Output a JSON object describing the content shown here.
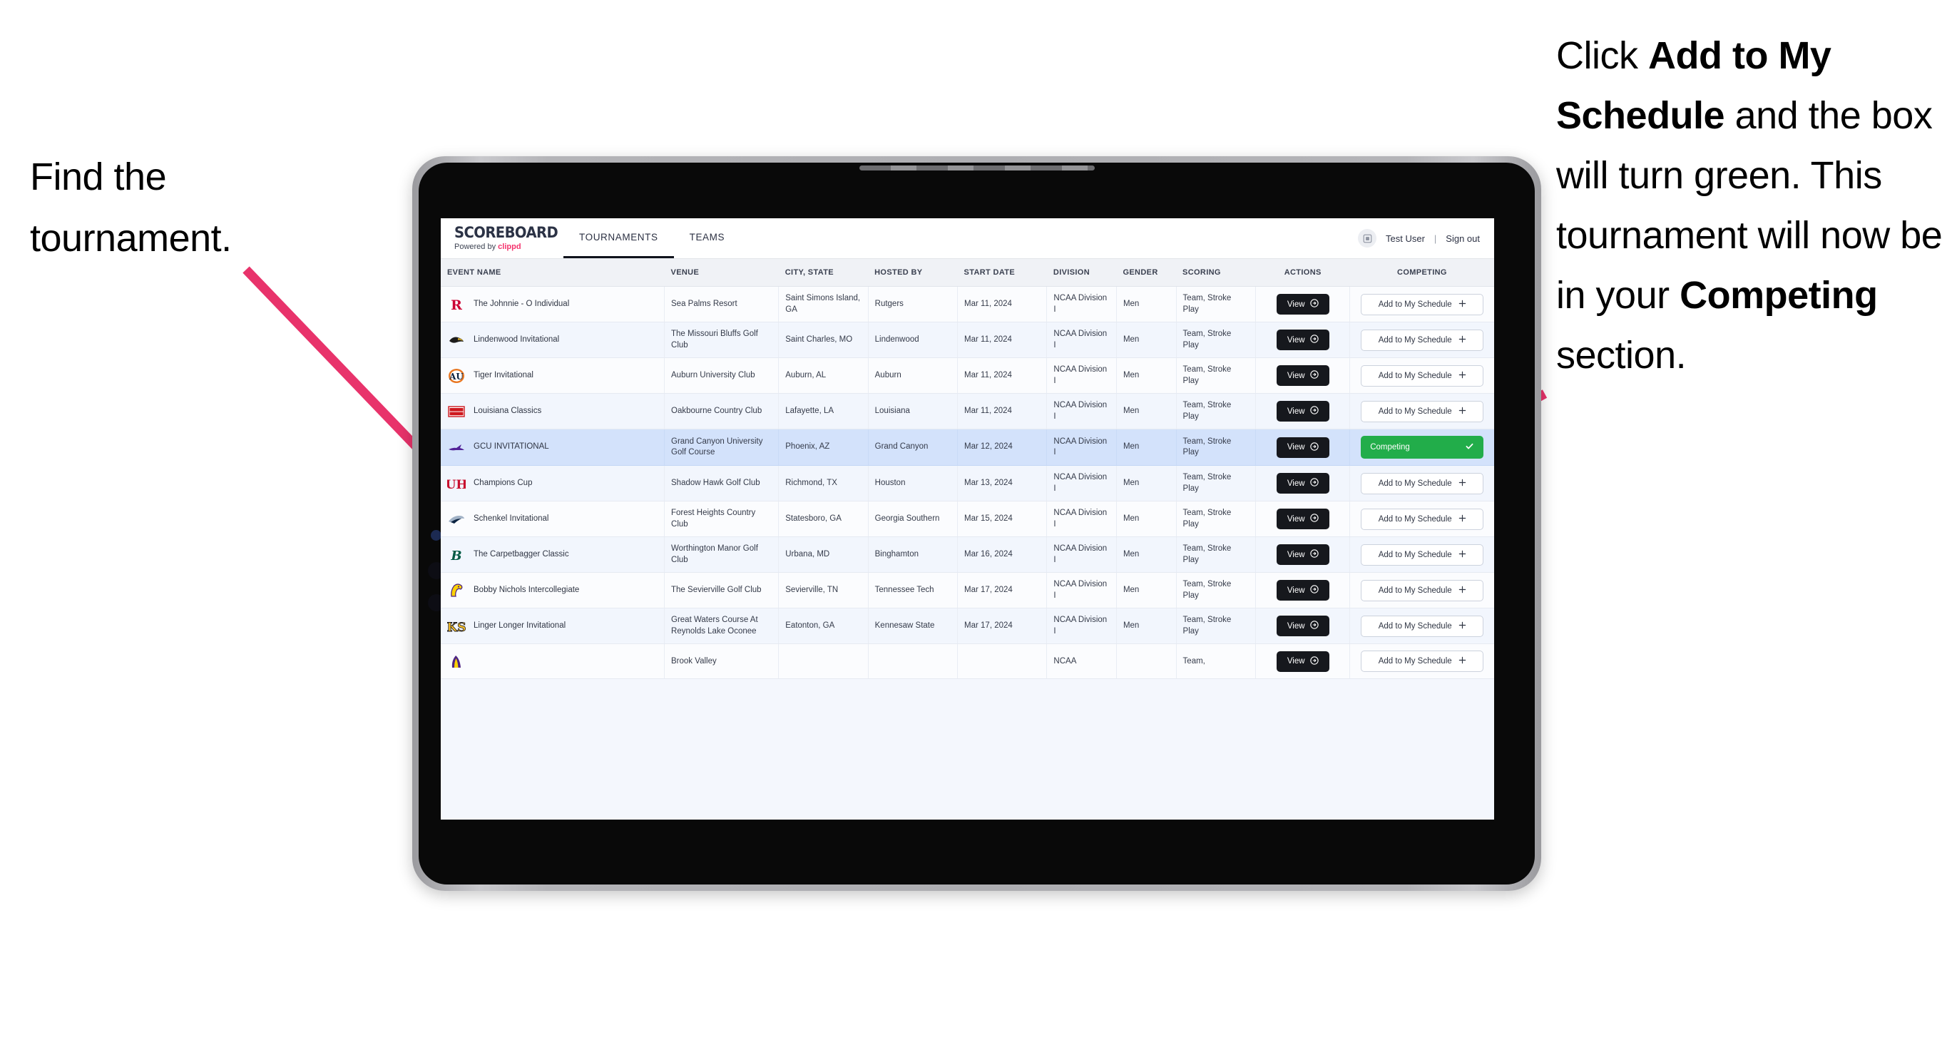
{
  "annotations": {
    "left": {
      "lines": [
        "Find the",
        "tournament."
      ]
    },
    "right": {
      "segments": [
        {
          "text": "Click ",
          "bold": false
        },
        {
          "text": "Add to My Schedule",
          "bold": true
        },
        {
          "text": " and the box will turn green. This tournament will now be in your ",
          "bold": false
        },
        {
          "text": "Competing",
          "bold": true
        },
        {
          "text": " section.",
          "bold": false
        }
      ]
    },
    "arrow_color": "#E8336B"
  },
  "app": {
    "brand": {
      "title": "SCOREBOARD",
      "powered_prefix": "Powered by ",
      "powered_brand": "clippd"
    },
    "tabs": [
      {
        "label": "TOURNAMENTS",
        "active": true
      },
      {
        "label": "TEAMS",
        "active": false
      }
    ],
    "account": {
      "user": "Test User",
      "separator": "|",
      "sign_out": "Sign out",
      "avatar_icon": "user-avatar-icon"
    },
    "table": {
      "columns": [
        "EVENT NAME",
        "VENUE",
        "CITY, STATE",
        "HOSTED BY",
        "START DATE",
        "DIVISION",
        "GENDER",
        "SCORING",
        "ACTIONS",
        "COMPETING"
      ],
      "view_label": "View",
      "add_label": "Add to My Schedule",
      "add_icon": "plus-icon",
      "competing_label": "Competing",
      "competing_icon": "check-icon",
      "rows": [
        {
          "event": "The Johnnie - O Individual",
          "venue": "Sea Palms Resort",
          "city": "Saint Simons Island, GA",
          "host": "Rutgers",
          "date": "Mar 11, 2024",
          "division": "NCAA Division I",
          "gender": "Men",
          "scoring": "Team, Stroke Play",
          "competing": false,
          "logo": "rutgers-logo"
        },
        {
          "event": "Lindenwood Invitational",
          "venue": "The Missouri Bluffs Golf Club",
          "city": "Saint Charles, MO",
          "host": "Lindenwood",
          "date": "Mar 11, 2024",
          "division": "NCAA Division I",
          "gender": "Men",
          "scoring": "Team, Stroke Play",
          "competing": false,
          "logo": "lindenwood-logo"
        },
        {
          "event": "Tiger Invitational",
          "venue": "Auburn University Club",
          "city": "Auburn, AL",
          "host": "Auburn",
          "date": "Mar 11, 2024",
          "division": "NCAA Division I",
          "gender": "Men",
          "scoring": "Team, Stroke Play",
          "competing": false,
          "logo": "auburn-logo"
        },
        {
          "event": "Louisiana Classics",
          "venue": "Oakbourne Country Club",
          "city": "Lafayette, LA",
          "host": "Louisiana",
          "date": "Mar 11, 2024",
          "division": "NCAA Division I",
          "gender": "Men",
          "scoring": "Team, Stroke Play",
          "competing": false,
          "logo": "louisiana-logo"
        },
        {
          "event": "GCU INVITATIONAL",
          "venue": "Grand Canyon University Golf Course",
          "city": "Phoenix, AZ",
          "host": "Grand Canyon",
          "date": "Mar 12, 2024",
          "division": "NCAA Division I",
          "gender": "Men",
          "scoring": "Team, Stroke Play",
          "competing": true,
          "logo": "grand-canyon-logo"
        },
        {
          "event": "Champions Cup",
          "venue": "Shadow Hawk Golf Club",
          "city": "Richmond, TX",
          "host": "Houston",
          "date": "Mar 13, 2024",
          "division": "NCAA Division I",
          "gender": "Men",
          "scoring": "Team, Stroke Play",
          "competing": false,
          "logo": "houston-logo"
        },
        {
          "event": "Schenkel Invitational",
          "venue": "Forest Heights Country Club",
          "city": "Statesboro, GA",
          "host": "Georgia Southern",
          "date": "Mar 15, 2024",
          "division": "NCAA Division I",
          "gender": "Men",
          "scoring": "Team, Stroke Play",
          "competing": false,
          "logo": "georgia-southern-logo"
        },
        {
          "event": "The Carpetbagger Classic",
          "venue": "Worthington Manor Golf Club",
          "city": "Urbana, MD",
          "host": "Binghamton",
          "date": "Mar 16, 2024",
          "division": "NCAA Division I",
          "gender": "Men",
          "scoring": "Team, Stroke Play",
          "competing": false,
          "logo": "binghamton-logo"
        },
        {
          "event": "Bobby Nichols Intercollegiate",
          "venue": "The Sevierville Golf Club",
          "city": "Sevierville, TN",
          "host": "Tennessee Tech",
          "date": "Mar 17, 2024",
          "division": "NCAA Division I",
          "gender": "Men",
          "scoring": "Team, Stroke Play",
          "competing": false,
          "logo": "tennessee-tech-logo"
        },
        {
          "event": "Linger Longer Invitational",
          "venue": "Great Waters Course At Reynolds Lake Oconee",
          "city": "Eatonton, GA",
          "host": "Kennesaw State",
          "date": "Mar 17, 2024",
          "division": "NCAA Division I",
          "gender": "Men",
          "scoring": "Team, Stroke Play",
          "competing": false,
          "logo": "kennesaw-state-logo"
        },
        {
          "event": "",
          "venue": "Brook Valley",
          "city": "",
          "host": "",
          "date": "",
          "division": "NCAA",
          "gender": "",
          "scoring": "Team,",
          "competing": false,
          "logo": "partial-logo",
          "partial": true
        }
      ]
    }
  }
}
